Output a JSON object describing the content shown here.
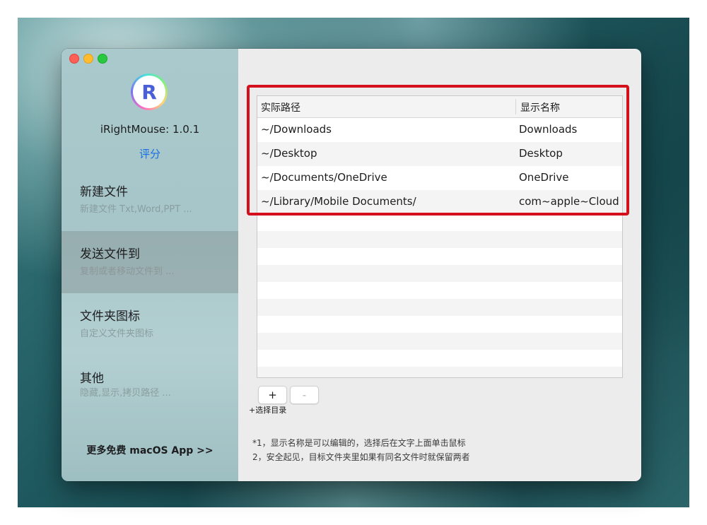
{
  "sidebar": {
    "logo_letter": "R",
    "app_version": "iRightMouse: 1.0.1",
    "rate_link": "评分",
    "items": [
      {
        "title": "新建文件",
        "subtitle": "新建文件 Txt,Word,PPT ..."
      },
      {
        "title": "发送文件到",
        "subtitle": "复制或者移动文件到 ..."
      },
      {
        "title": "文件夹图标",
        "subtitle": "自定义文件夹图标"
      },
      {
        "title": "其他",
        "subtitle": "隐藏,显示,拷贝路径 ..."
      }
    ],
    "selected_index": 1,
    "more_link": "更多免费 macOS App >>"
  },
  "table": {
    "columns": [
      "实际路径",
      "显示名称"
    ],
    "rows": [
      [
        "~/Downloads",
        "Downloads"
      ],
      [
        "~/Desktop",
        "Desktop"
      ],
      [
        "~/Documents/OneDrive",
        "OneDrive"
      ],
      [
        "~/Library/Mobile Documents/",
        "com~apple~Cloud"
      ]
    ]
  },
  "buttons": {
    "add_label": "+",
    "remove_label": "-",
    "choose_dir": "+选择目录"
  },
  "notes": [
    "*1，显示名称是可以编辑的，选择后在文字上面单击鼠标",
    "2，安全起见，目标文件夹里如果有同名文件时就保留两者"
  ],
  "colors": {
    "highlight_border": "#d4101c",
    "link_blue": "#1a6fe0"
  }
}
